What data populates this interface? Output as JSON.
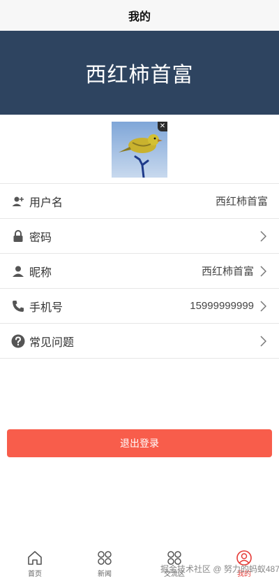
{
  "header": {
    "title": "我的"
  },
  "profile": {
    "display_name": "西红柿首富",
    "avatar_close_glyph": "✕"
  },
  "list": {
    "rows": [
      {
        "icon": "user-add-icon",
        "label": "用户名",
        "value": "西红柿首富",
        "chevron": false
      },
      {
        "icon": "lock-icon",
        "label": "密码",
        "value": "",
        "chevron": true
      },
      {
        "icon": "person-icon",
        "label": "昵称",
        "value": "西红柿首富",
        "chevron": true
      },
      {
        "icon": "phone-icon",
        "label": "手机号",
        "value": "15999999999",
        "chevron": true
      },
      {
        "icon": "help-circle-icon",
        "label": "常见问题",
        "value": "",
        "chevron": true
      }
    ]
  },
  "actions": {
    "logout_label": "退出登录"
  },
  "tabbar": {
    "tabs": [
      {
        "label": "首页",
        "icon": "home-icon",
        "active": false
      },
      {
        "label": "新闻",
        "icon": "grid-icon",
        "active": false
      },
      {
        "label": "交流区",
        "icon": "grid-icon",
        "active": false
      },
      {
        "label": "我的",
        "icon": "user-circle-icon",
        "active": true
      }
    ]
  },
  "watermark": {
    "text": "掘金技术社区 @ 努力的蚂蚁487"
  },
  "colors": {
    "header_bg": "#2e4460",
    "logout_bg": "#f85d4b",
    "active_tab": "#e53935"
  }
}
